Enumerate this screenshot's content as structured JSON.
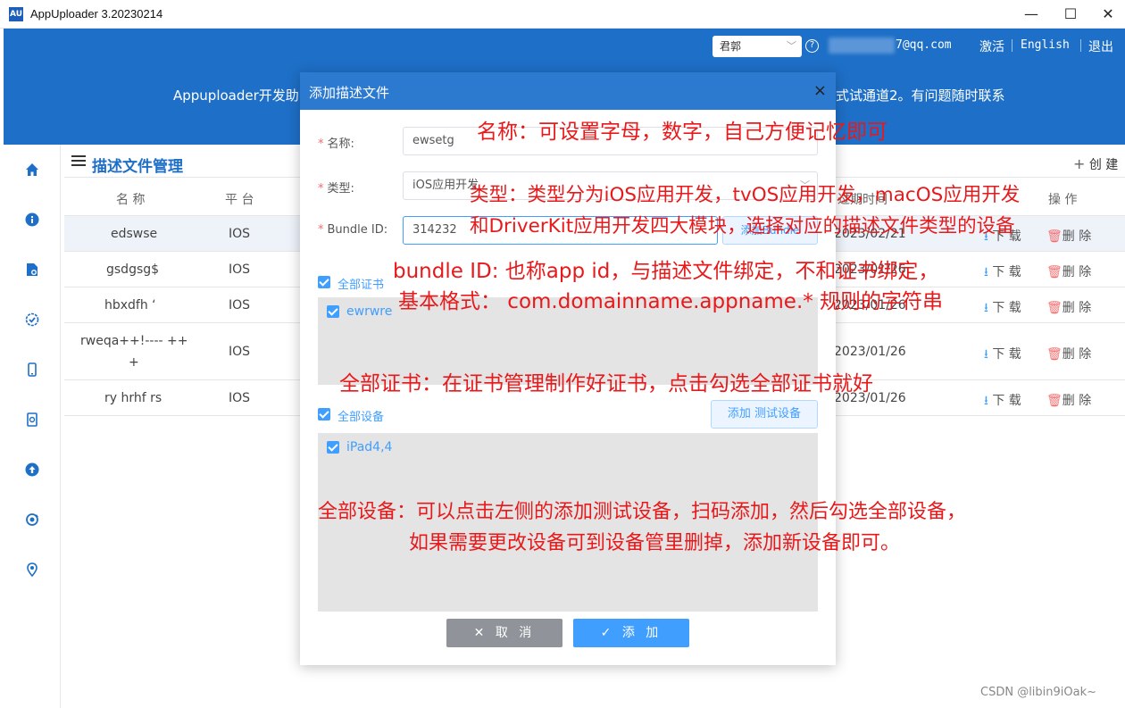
{
  "window": {
    "app_icon": "AU",
    "title": "AppUploader 3.20230214",
    "minimize": "—",
    "maximize": "☐",
    "close": "✕"
  },
  "header": {
    "user_select": "君郭",
    "email_tail": "7@qq.com",
    "activate": "激活",
    "english": "English",
    "logout": "退出",
    "notice_left": "Appuploader开发助",
    "notice_right": "式试通道2。有问题随时联系"
  },
  "sidebar": {
    "icons": [
      "home-icon",
      "info-icon",
      "certificate-icon",
      "verified-icon",
      "device-icon",
      "profile-file-icon",
      "upload-icon",
      "sync-icon",
      "location-icon"
    ]
  },
  "main": {
    "page_title": "描述文件管理",
    "create_label": "创 建",
    "columns": {
      "name": "名 称",
      "platform": "平 台",
      "expiry": "过期时间",
      "action": "操 作"
    },
    "rows": [
      {
        "name": "edswse",
        "platform": "IOS",
        "expiry": "2023/02/21"
      },
      {
        "name": "gsdgsg$",
        "platform": "IOS",
        "expiry": "2023/01/26"
      },
      {
        "name": "hbxdfh ‘",
        "platform": "IOS",
        "expiry": "2023/01/26"
      },
      {
        "name": "rweqa++!---- ++",
        "name2": "+",
        "platform": "IOS",
        "expiry": "2023/01/26"
      },
      {
        "name": "ry hrhf rs",
        "platform": "IOS",
        "expiry": "2023/01/26"
      }
    ],
    "download_label": "下 载",
    "delete_label": "删 除"
  },
  "dialog": {
    "title": "添加描述文件",
    "close": "×",
    "name_label": "名称:",
    "name_value": "ewsetg",
    "type_label": "类型:",
    "type_value": "iOS应用开发",
    "bundle_label": "Bundle ID:",
    "bundle_value": "314232",
    "add_bundle": "添加Bundle",
    "all_certs": "全部证书",
    "cert_item": "ewrwre",
    "all_devices": "全部设备",
    "add_test_device": "添加 测试设备",
    "device_item": "iPad4,4",
    "cancel": "✕ 取 消",
    "add": "✓ 添 加"
  },
  "annotations": {
    "name_note": "名称：可设置字母，数字，自己方便记忆即可",
    "type_note_1": "类型：类型分为iOS应用开发，tvOS应用开发，macOS应用开发",
    "type_note_2": "和DriverKit应用开发四大模块，选择对应的描述文件类型的设备",
    "bundle_note_1": "bundle ID: 也称app id，与描述文件绑定，不和证书绑定，",
    "bundle_note_2": "基本格式：  com.domainname.appname.* 规则的字符串",
    "cert_note": "全部证书：在证书管理制作好证书，点击勾选全部证书就好",
    "device_note_1": "全部设备：可以点击左侧的添加测试设备，扫码添加，然后勾选全部设备，",
    "device_note_2": "如果需要更改设备可到设备管里删掉，添加新设备即可。"
  },
  "watermark": "CSDN @libin9iOak~",
  "colors": {
    "header_blue": "#1e6fc7",
    "accent": "#409eff",
    "annotation_red": "#e8191b",
    "delete_red": "#f56c6c"
  }
}
